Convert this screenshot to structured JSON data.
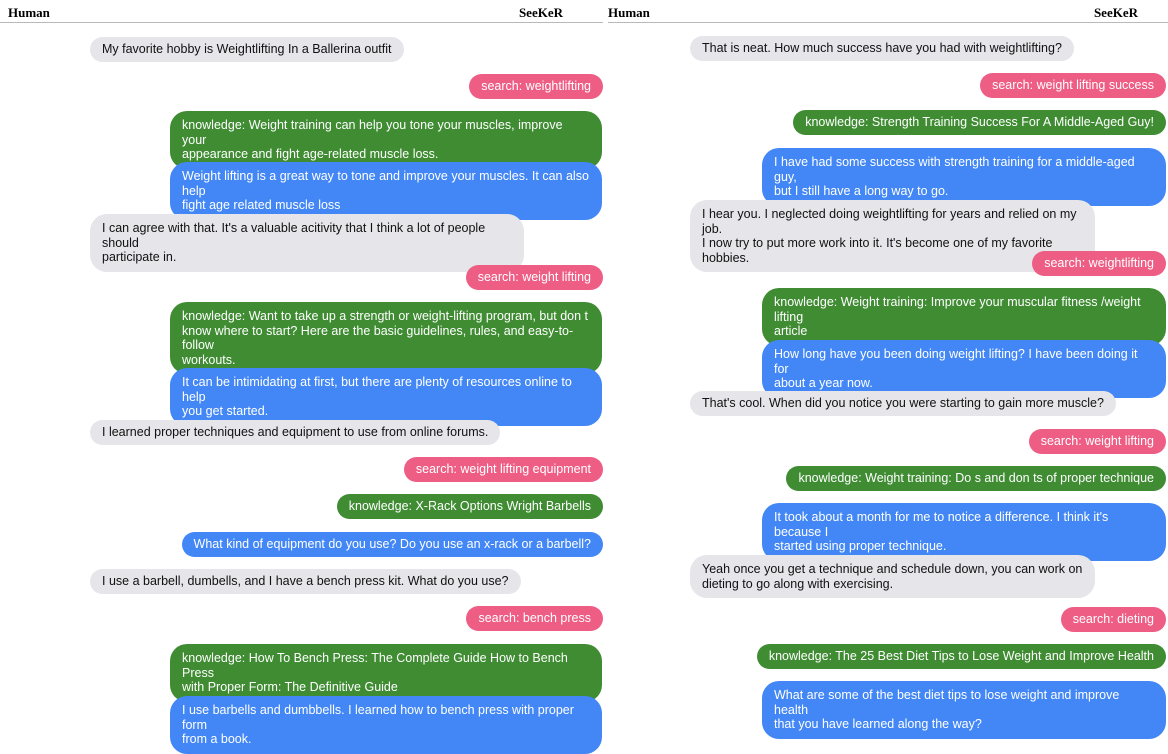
{
  "header": {
    "human_label": "Human",
    "bot_label": "SeeKeR"
  },
  "left": {
    "messages": [
      {
        "text": "My favorite hobby is Weightlifting In a Ballerina outfit"
      },
      {
        "text": "search: weightlifting"
      },
      {
        "text": "knowledge: Weight training can help you tone your muscles, improve your\nappearance and fight age-related muscle loss."
      },
      {
        "text": "Weight lifting is a great way to tone and improve your muscles. It can also help\nfight age related muscle loss"
      },
      {
        "text": "I can agree with that. It's a valuable acitivity that I think a lot of people should\nparticipate in."
      },
      {
        "text": "search: weight lifting"
      },
      {
        "text": "knowledge: Want to take up a strength or weight-lifting program, but don t\nknow where to start? Here are the basic guidelines, rules, and easy-to-follow\nworkouts."
      },
      {
        "text": "It can be intimidating at first, but there are plenty of resources online to help\nyou get started."
      },
      {
        "text": "I learned proper techniques and equipment to use from online forums."
      },
      {
        "text": "search: weight lifting equipment"
      },
      {
        "text": "knowledge: X-Rack Options Wright Barbells"
      },
      {
        "text": "What kind of equipment do you use? Do you use an x-rack or a barbell?"
      },
      {
        "text": "I use a barbell, dumbells, and I have a bench press kit. What do you use?"
      },
      {
        "text": "search: bench press"
      },
      {
        "text": "knowledge: How To Bench Press: The Complete Guide How to Bench Press\nwith Proper Form: The Definitive Guide"
      },
      {
        "text": "I use barbells and dumbbells. I learned how to bench press with proper form\nfrom a book."
      }
    ]
  },
  "right": {
    "messages": [
      {
        "text": "That is neat. How much success have you had with weightlifting?"
      },
      {
        "text": "search: weight lifting success"
      },
      {
        "text": "knowledge: Strength Training Success For A Middle-Aged Guy!"
      },
      {
        "text": "I have had some success with strength training for a middle-aged guy,\nbut I still have a long way to go."
      },
      {
        "text": "I hear you. I neglected doing weightlifting for years and relied on my job.\nI now try to put more work into it. It's become one of my favorite hobbies."
      },
      {
        "text": "search: weightlifting"
      },
      {
        "text": "knowledge: Weight training: Improve your muscular fitness /weight lifting\narticle"
      },
      {
        "text": "How long have you been doing weight lifting? I have been doing it for\nabout a year now."
      },
      {
        "text": "That's cool. When did you notice you were starting to gain more muscle?"
      },
      {
        "text": "search: weight lifting"
      },
      {
        "text": "knowledge: Weight training: Do s and don ts of proper technique"
      },
      {
        "text": "It took about a month for me to notice a difference. I think it's because I\nstarted using proper technique."
      },
      {
        "text": "Yeah once you get a technique and schedule down, you can work on\ndieting to go along with exercising."
      },
      {
        "text": "search: dieting"
      },
      {
        "text": "knowledge: The 25 Best Diet Tips to Lose Weight and Improve Health"
      },
      {
        "text": "What are some of the best diet tips to lose weight and improve health\nthat you have learned along the way?"
      }
    ]
  }
}
